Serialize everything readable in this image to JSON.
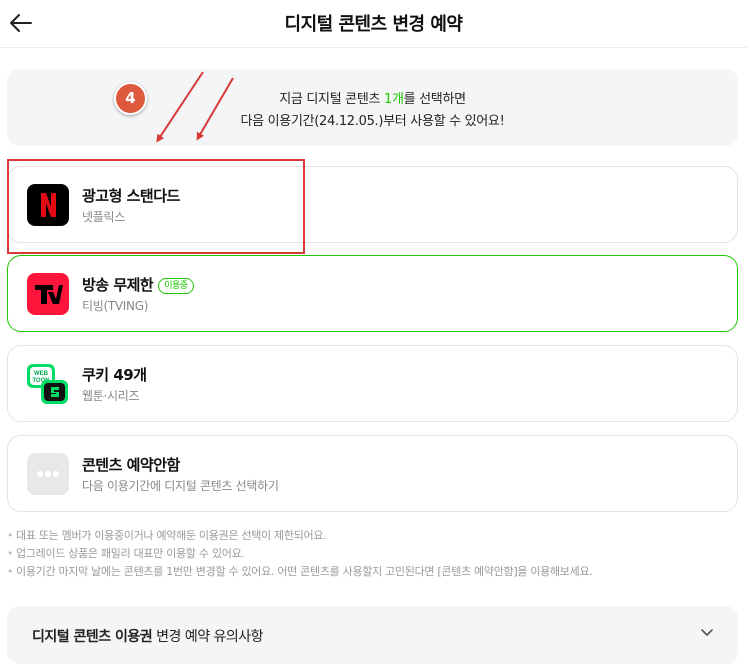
{
  "header": {
    "title": "디지털 콘텐츠 변경 예약"
  },
  "notice": {
    "line1_before": "지금 디지털 콘텐츠 ",
    "line1_count": "1개",
    "line1_after": "를 선택하면",
    "line2": "다음 이용기간(24.12.05.)부터 사용할 수 있어요!"
  },
  "step_badge": "4",
  "options": [
    {
      "title": "광고형 스탠다드",
      "subtitle": "넷플릭스",
      "icon": "netflix-logo-icon"
    },
    {
      "title": "방송 무제한",
      "badge": "이용중",
      "subtitle": "티빙(TVING)",
      "icon": "tving-logo-icon"
    },
    {
      "title": "쿠키 49개",
      "subtitle": "웹툰·시리즈",
      "icon": "webtoon-logo-icon"
    },
    {
      "title": "콘텐츠 예약안함",
      "subtitle": "다음 이용기간에 디지털 콘텐츠 선택하기",
      "icon": "more-dots-icon"
    }
  ],
  "notes": [
    "대표 또는 멤버가 이용중이거나 예약해둔 이용권은 선택이 제한되어요.",
    "업그레이드 상품은 패밀리 대표만 이용할 수 있어요.",
    "이용기간 마지막 날에는 콘텐츠를 1번만 변경할 수 있어요. 어떤 콘텐츠를 사용할지 고민된다면 [콘텐츠 예약안함]을 이용해보세요."
  ],
  "accordion": {
    "title_bold": "디지털 콘텐츠 이용권",
    "title_rest": " 변경 예약 유의사항"
  },
  "colors": {
    "accent_green": "#1ec800",
    "annotation_red": "#d73838",
    "badge_orange": "#dd5a3c",
    "netflix_red": "#e50914",
    "tving_red": "#ff153c",
    "webtoon_green": "#00dc64"
  }
}
